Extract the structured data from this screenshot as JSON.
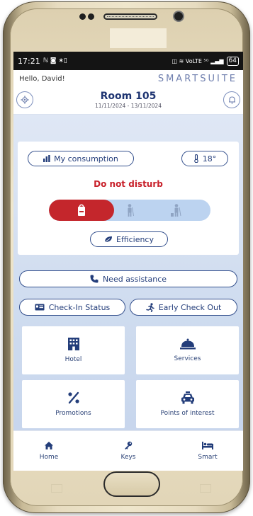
{
  "statusbar": {
    "time": "17:21",
    "left_icons": "ℕ ◙ ∗▯",
    "right_icons": "◫ ≋ VoLTE ⁵ᴳ ▂▄▆",
    "battery": "64"
  },
  "header": {
    "greeting": "Hello, David!",
    "brand": "SMARTSUITE"
  },
  "room": {
    "title": "Room 105",
    "dates": "11/11/2024 - 13/11/2024"
  },
  "controls": {
    "consumption_label": "My consumption",
    "temperature": "18°",
    "status": "Do not disturb",
    "efficiency_label": "Efficiency"
  },
  "actions": {
    "assistance_label": "Need assistance",
    "checkin_label": "Check-In Status",
    "early_checkout_label": "Early Check Out"
  },
  "tiles": [
    {
      "label": "Hotel",
      "icon": "building-icon"
    },
    {
      "label": "Services",
      "icon": "cloche-icon"
    },
    {
      "label": "Promotions",
      "icon": "percent-icon"
    },
    {
      "label": "Points of interest",
      "icon": "taxi-icon"
    }
  ],
  "nav": [
    {
      "label": "Home",
      "icon": "home-icon"
    },
    {
      "label": "Keys",
      "icon": "key-icon"
    },
    {
      "label": "Smart",
      "icon": "bed-icon"
    }
  ],
  "colors": {
    "primary": "#1f3572",
    "accent_red": "#c4262c",
    "switch_bg": "#bcd3f0",
    "background": "#cfdcef"
  }
}
